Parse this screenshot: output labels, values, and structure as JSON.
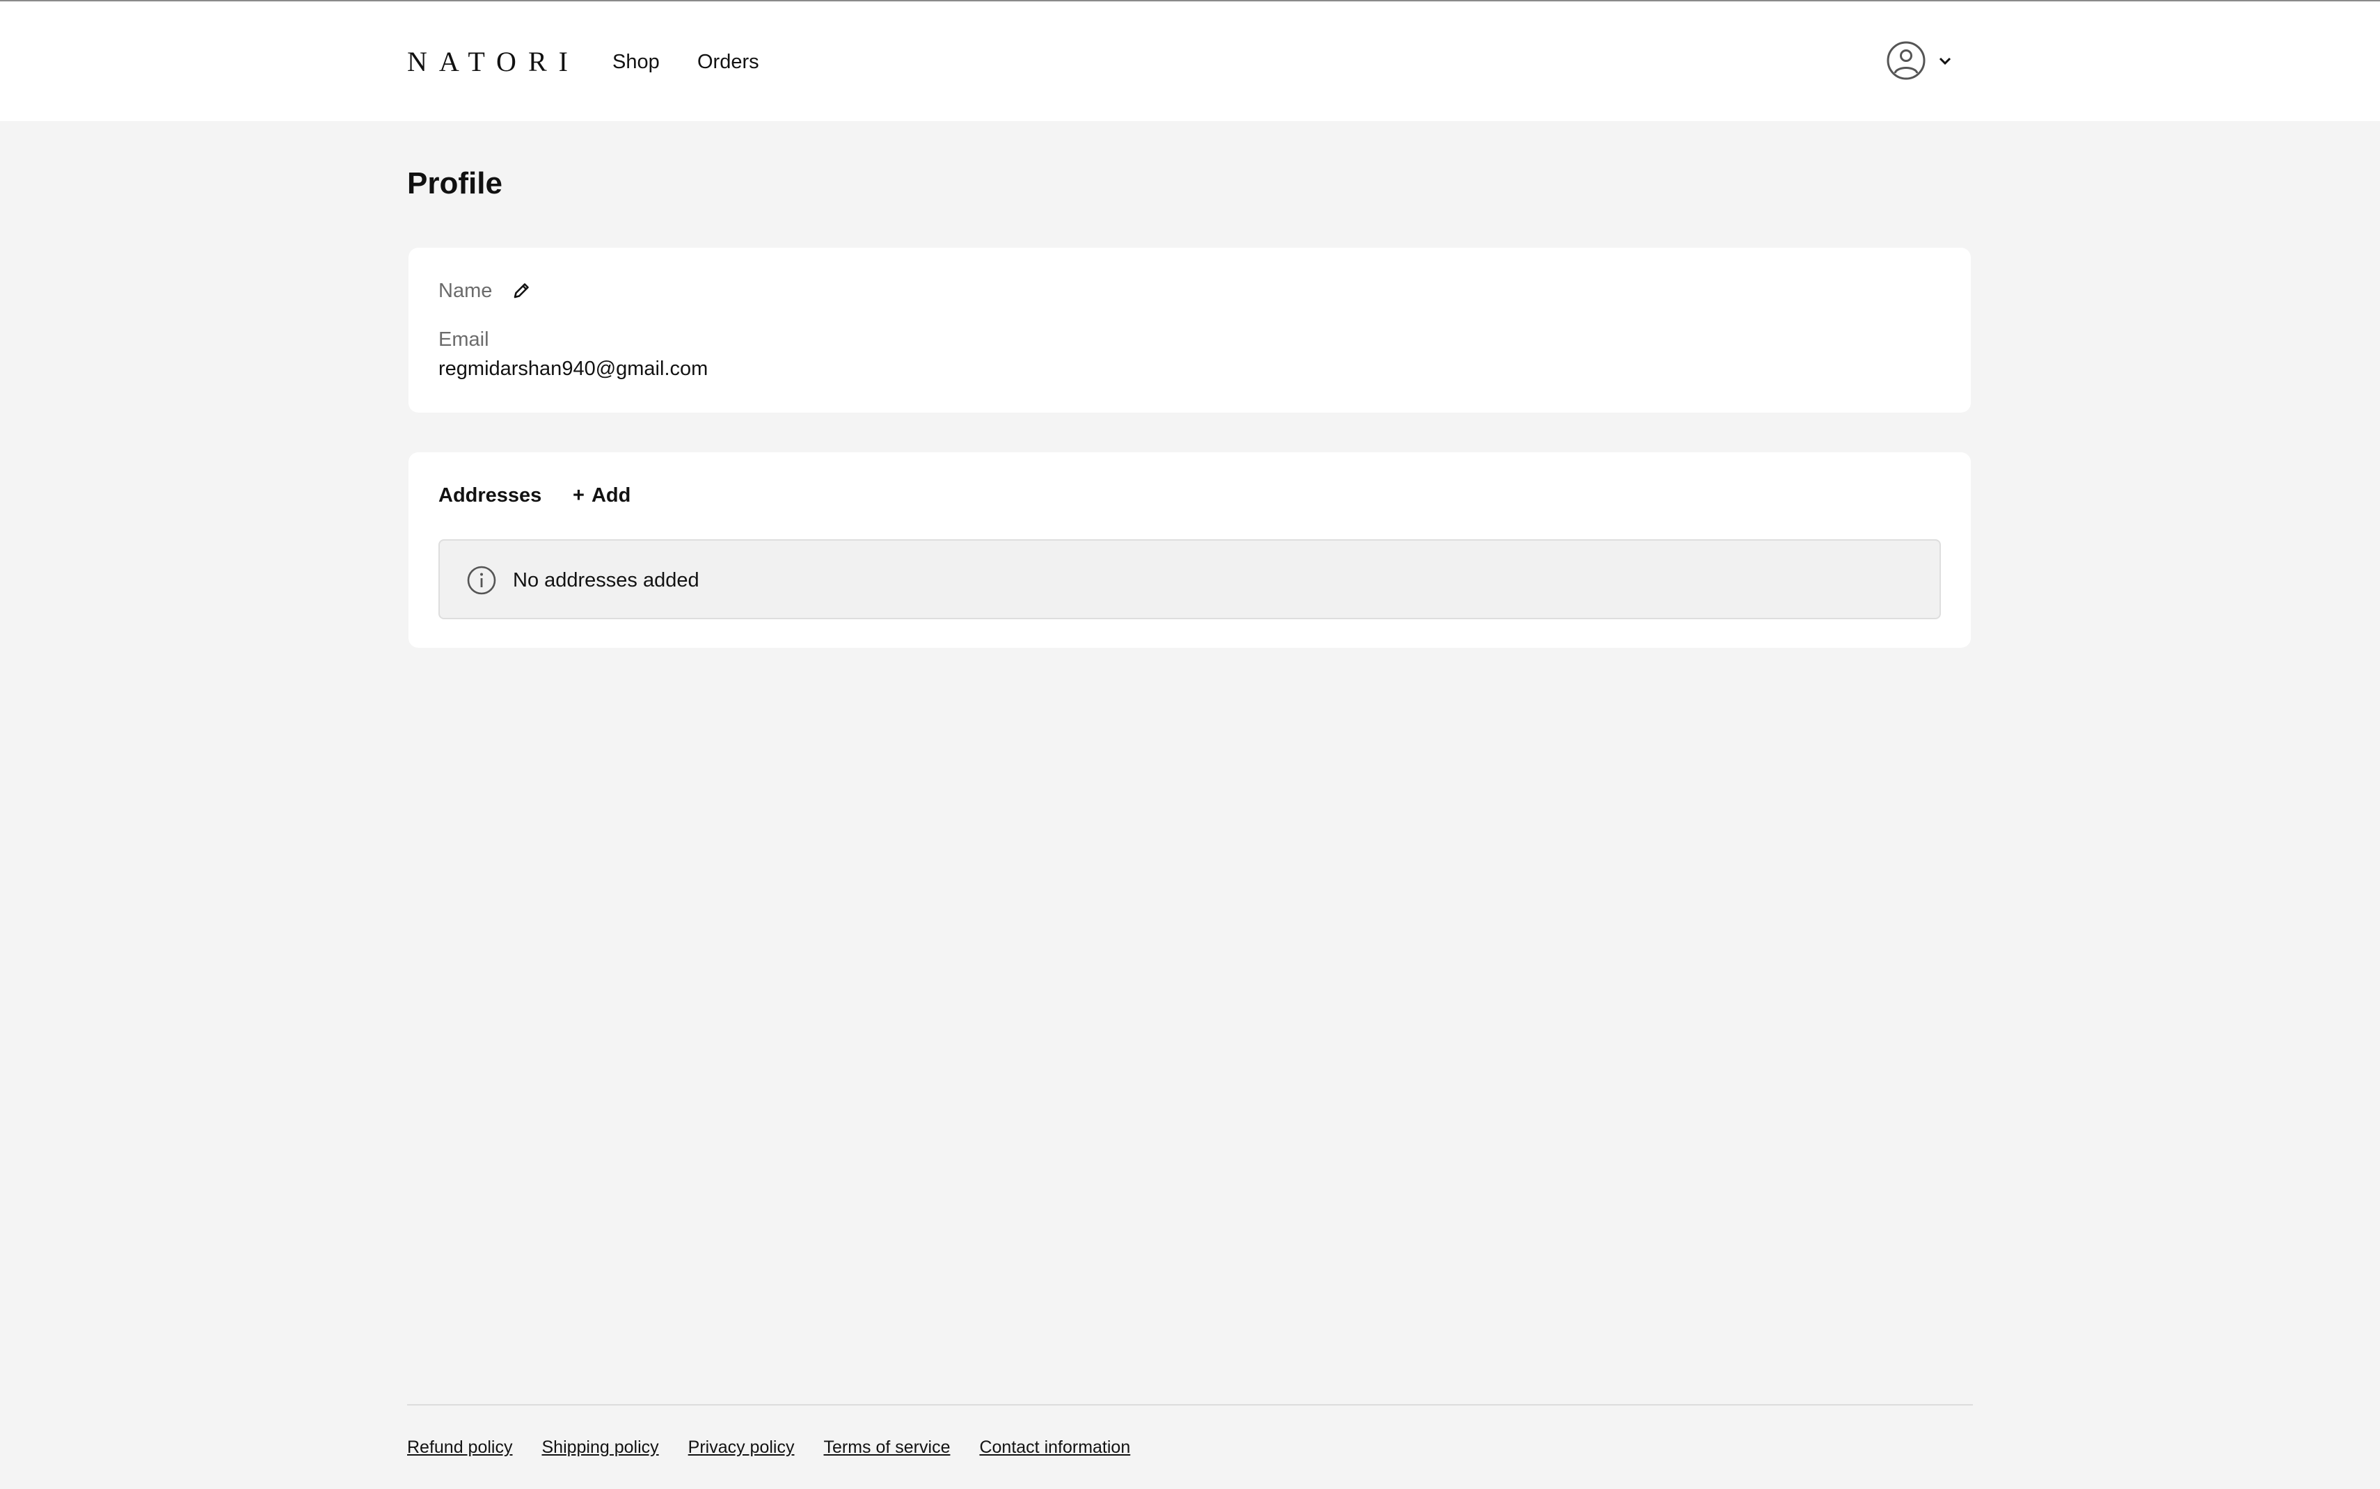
{
  "header": {
    "logo": "NATORI",
    "nav": {
      "shop": "Shop",
      "orders": "Orders"
    },
    "account_icon": "user-circle-icon"
  },
  "page": {
    "title": "Profile"
  },
  "profile": {
    "name_label": "Name",
    "email_label": "Email",
    "email_value": "regmidarshan940@gmail.com"
  },
  "addresses": {
    "heading": "Addresses",
    "add_label": "Add",
    "empty_message": "No addresses added"
  },
  "footer": {
    "links": [
      "Refund policy",
      "Shipping policy",
      "Privacy policy",
      "Terms of service",
      "Contact information"
    ]
  },
  "colors": {
    "background": "#f4f4f4",
    "card": "#ffffff",
    "text": "#121212",
    "muted": "#6b6b6b"
  }
}
